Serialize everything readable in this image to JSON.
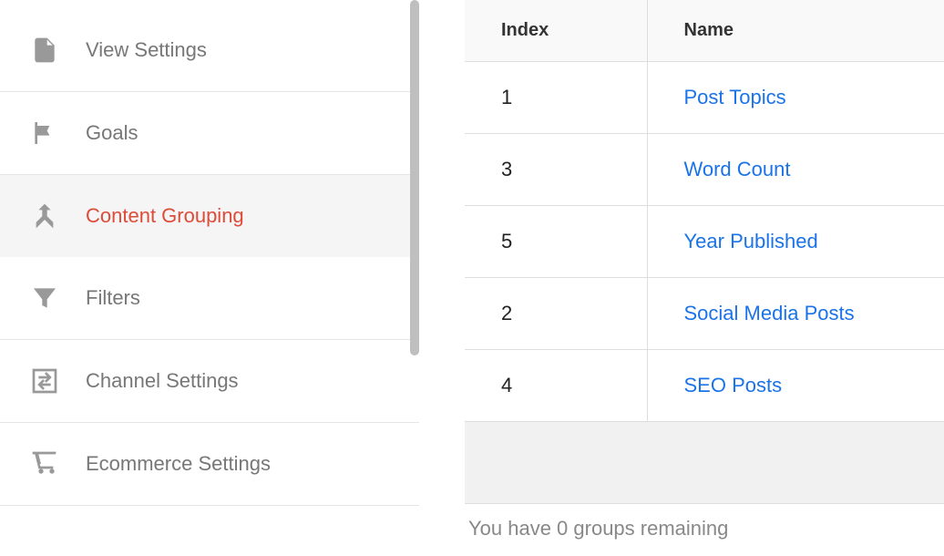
{
  "sidebar": {
    "items": [
      {
        "id": "view-settings",
        "label": "View Settings",
        "active": false
      },
      {
        "id": "goals",
        "label": "Goals",
        "active": false
      },
      {
        "id": "content-grouping",
        "label": "Content Grouping",
        "active": true
      },
      {
        "id": "filters",
        "label": "Filters",
        "active": false
      },
      {
        "id": "channel-settings",
        "label": "Channel Settings",
        "active": false
      },
      {
        "id": "ecommerce-settings",
        "label": "Ecommerce Settings",
        "active": false
      }
    ]
  },
  "table": {
    "headers": {
      "index": "Index",
      "name": "Name"
    },
    "rows": [
      {
        "index": "1",
        "name": "Post Topics"
      },
      {
        "index": "3",
        "name": "Word Count"
      },
      {
        "index": "5",
        "name": "Year Published"
      },
      {
        "index": "2",
        "name": "Social Media Posts"
      },
      {
        "index": "4",
        "name": "SEO Posts"
      }
    ]
  },
  "remaining_text": "You have 0 groups remaining"
}
